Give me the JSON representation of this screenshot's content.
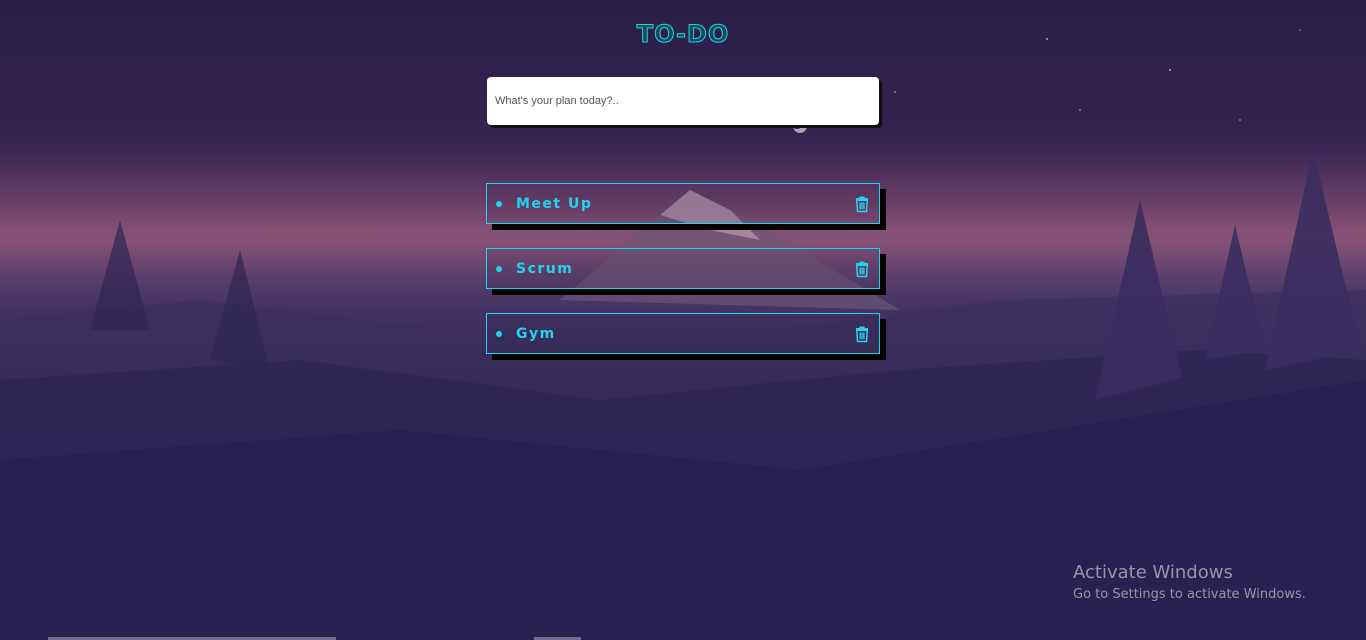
{
  "app": {
    "title": "TO-DO"
  },
  "input": {
    "placeholder": "What's your plan today?..",
    "value": ""
  },
  "todos": [
    {
      "text": "Meet Up",
      "delete_icon": "trash-icon"
    },
    {
      "text": "Scrum",
      "delete_icon": "trash-icon"
    },
    {
      "text": "Gym",
      "delete_icon": "trash-icon"
    }
  ],
  "watermark": {
    "title": "Activate Windows",
    "subtitle": "Go to Settings to activate Windows."
  },
  "colors": {
    "accent": "#22d3ee",
    "background": "#2a1f47",
    "shadow": "#000000"
  }
}
